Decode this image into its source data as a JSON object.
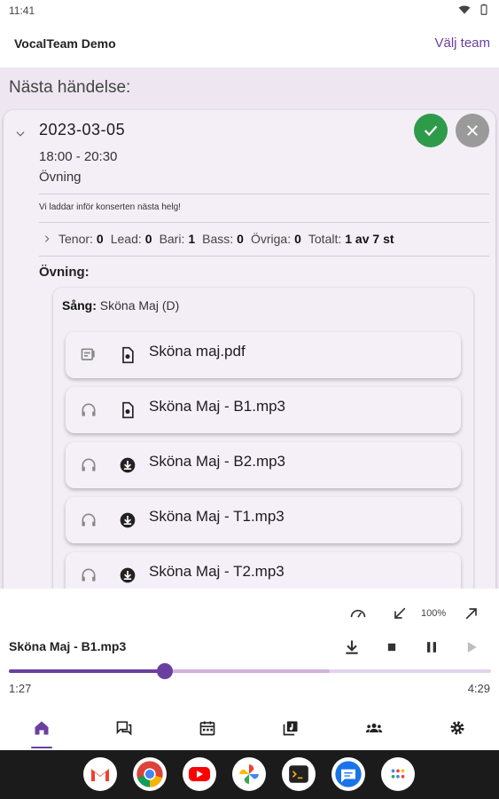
{
  "status_bar": {
    "time": "11:41"
  },
  "app_bar": {
    "title": "VocalTeam Demo",
    "action": "Välj team"
  },
  "section": {
    "title": "Nästa händelse:"
  },
  "event": {
    "date": "2023-03-05",
    "time_range": "18:00 - 20:30",
    "type": "Övning",
    "description": "Vi laddar inför konserten nästa helg!",
    "voices": [
      {
        "label": "Tenor:",
        "value": "0"
      },
      {
        "label": "Lead:",
        "value": "0"
      },
      {
        "label": "Bari:",
        "value": "1"
      },
      {
        "label": "Bass:",
        "value": "0"
      },
      {
        "label": "Övriga:",
        "value": "0"
      },
      {
        "label": "Totalt:",
        "value": "1 av 7 st"
      }
    ],
    "practice_label": "Övning:",
    "song_label": "Sång:",
    "song_name": "Sköna Maj (D)",
    "files": [
      {
        "name": "Sköna maj.pdf",
        "lead_icon": "sheet-music-icon",
        "state_icon": "file-icon"
      },
      {
        "name": "Sköna Maj - B1.mp3",
        "lead_icon": "headphones-icon",
        "state_icon": "file-icon"
      },
      {
        "name": "Sköna Maj - B2.mp3",
        "lead_icon": "headphones-icon",
        "state_icon": "download-circle-icon"
      },
      {
        "name": "Sköna Maj - T1.mp3",
        "lead_icon": "headphones-icon",
        "state_icon": "download-circle-icon"
      },
      {
        "name": "Sköna Maj - T2.mp3",
        "lead_icon": "headphones-icon",
        "state_icon": "download-circle-icon"
      }
    ]
  },
  "player": {
    "speed": "100%",
    "track": "Sköna Maj - B1.mp3",
    "elapsed": "1:27",
    "total": "4:29",
    "progress": 0.324,
    "buffered": 0.665
  },
  "colors": {
    "accent": "#6b3fa0",
    "accept": "#2e9b4a",
    "decline": "#9a9a9a",
    "fab": "#9b65b8"
  },
  "bottom_nav": [
    "home-icon",
    "chat-icon",
    "calendar-icon",
    "music-library-icon",
    "groups-icon",
    "settings-icon"
  ],
  "dock_apps": [
    "gmail-icon",
    "chrome-icon",
    "youtube-icon",
    "photos-icon",
    "terminal-icon",
    "messages-icon",
    "apps-icon"
  ]
}
